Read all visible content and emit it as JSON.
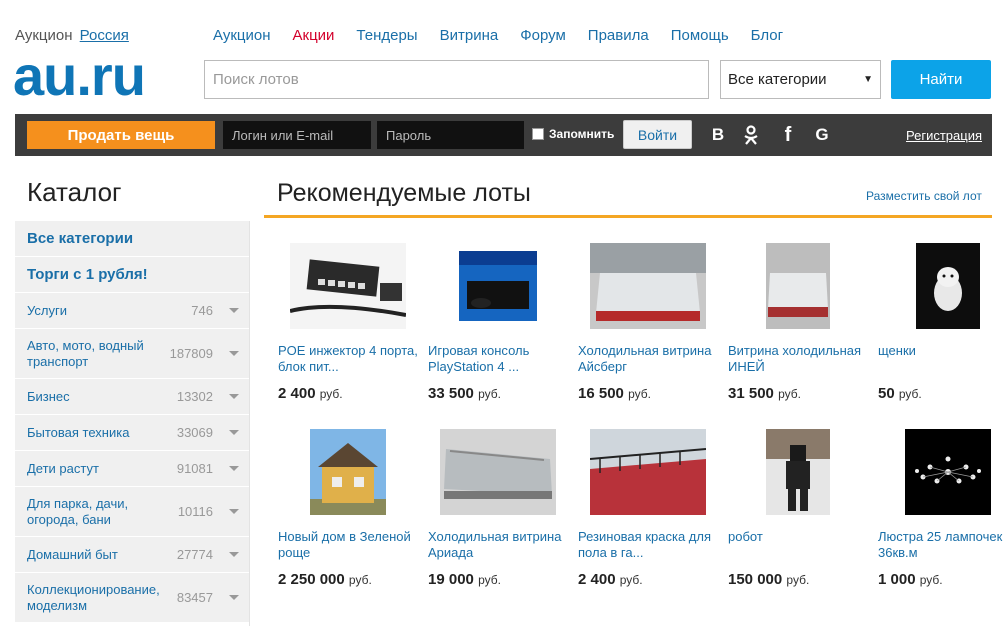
{
  "header": {
    "region_prefix": "Аукцион",
    "region_link": "Россия",
    "nav": [
      "Аукцион",
      "Акции",
      "Тендеры",
      "Витрина",
      "Форум",
      "Правила",
      "Помощь",
      "Блог"
    ],
    "logo": "au.ru",
    "search_placeholder": "Поиск лотов",
    "category_select": "Все категории",
    "search_button": "Найти"
  },
  "loginbar": {
    "sell_button": "Продать вещь",
    "login_placeholder": "Логин или E-mail",
    "password_placeholder": "Пароль",
    "remember": "Запомнить",
    "enter_button": "Войти",
    "social": [
      "В",
      "ok",
      "f",
      "G"
    ],
    "register": "Регистрация"
  },
  "sidebar": {
    "title": "Каталог",
    "items": [
      {
        "label": "Все категории",
        "count": ""
      },
      {
        "label": "Торги с 1 рубля!",
        "count": ""
      },
      {
        "label": "Услуги",
        "count": "746"
      },
      {
        "label": "Авто, мото, водный транспорт",
        "count": "187809"
      },
      {
        "label": "Бизнес",
        "count": "13302"
      },
      {
        "label": "Бытовая техника",
        "count": "33069"
      },
      {
        "label": "Дети растут",
        "count": "91081"
      },
      {
        "label": "Для парка, дачи, огорода, бани",
        "count": "10116"
      },
      {
        "label": "Домашний быт",
        "count": "27774"
      },
      {
        "label": "Коллекционирование, моделизм",
        "count": "83457"
      }
    ]
  },
  "main": {
    "title": "Рекомендуемые лоты",
    "place_link": "Разместить свой лот",
    "currency": "руб.",
    "lots": [
      {
        "name": "POE инжектор 4 порта, блок пит...",
        "price": "2 400",
        "icon": "network-switch-photo"
      },
      {
        "name": "Игровая консоль PlayStation 4 ...",
        "price": "33 500",
        "icon": "ps4-box-photo"
      },
      {
        "name": "Холодильная витрина Айсберг",
        "price": "16 500",
        "icon": "fridge-showcase-photo"
      },
      {
        "name": "Витрина холодильная ИНЕЙ",
        "price": "31 500",
        "icon": "fridge-showcase-photo"
      },
      {
        "name": "щенки",
        "price": "50",
        "icon": "puppy-photo"
      },
      {
        "name": "Новый дом в Зеленой роще",
        "price": "2 250 000",
        "icon": "house-photo"
      },
      {
        "name": "Холодильная витрина Ариада",
        "price": "19 000",
        "icon": "fridge-showcase-photo"
      },
      {
        "name": "Резиновая краска для пола в га...",
        "price": "2 400",
        "icon": "red-floor-photo"
      },
      {
        "name": "робот",
        "price": "150 000",
        "icon": "robot-photo"
      },
      {
        "name": "Люстра 25 лампочек 36кв.м",
        "price": "1 000",
        "icon": "chandelier-photo"
      }
    ]
  },
  "colors": {
    "brand_blue": "#0f75b6",
    "link_blue": "#1a6fa8",
    "accent_orange": "#f5901d",
    "search_button": "#0ca3e8",
    "dark_bar": "#3c3c3c"
  }
}
